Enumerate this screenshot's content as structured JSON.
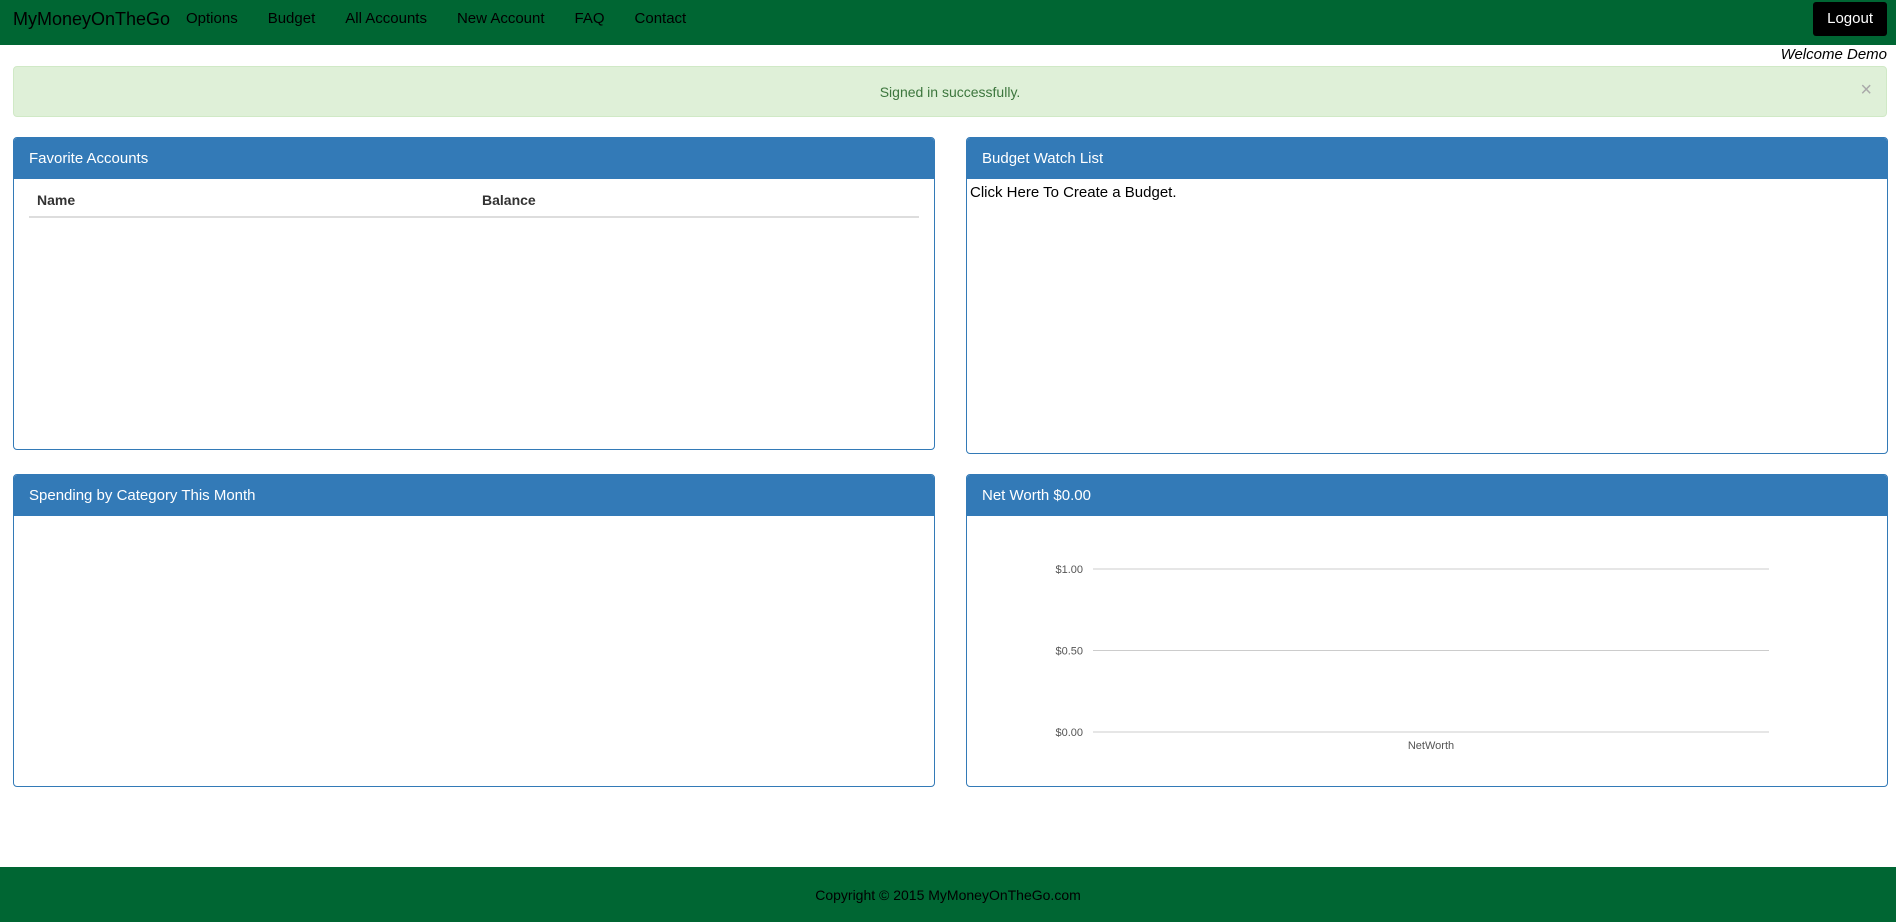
{
  "navbar": {
    "brand": "MyMoneyOnTheGo",
    "links": [
      "Options",
      "Budget",
      "All Accounts",
      "New Account",
      "FAQ",
      "Contact"
    ],
    "logout_label": "Logout",
    "color": "#006633"
  },
  "welcome": "Welcome Demo",
  "alert": {
    "message": "Signed in successfully.",
    "close_glyph": "×"
  },
  "favorite_accounts": {
    "title": "Favorite Accounts",
    "columns": [
      "Name",
      "Balance"
    ]
  },
  "budget_watch": {
    "title": "Budget Watch List",
    "link_text": "Click Here To Create a Budget."
  },
  "spending": {
    "title": "Spending by Category This Month"
  },
  "net_worth": {
    "title": "Net Worth $0.00"
  },
  "chart_data": {
    "type": "bar",
    "categories": [
      "NetWorth"
    ],
    "values": [
      0
    ],
    "yticks": [
      "$0.00",
      "$0.50",
      "$1.00"
    ],
    "ylim": [
      0,
      1
    ],
    "grid": true
  },
  "footer": {
    "copyright": "Copyright © 2015 MyMoneyOnTheGo.com"
  },
  "colors": {
    "panel": "#337ab7",
    "alert_bg": "#dff0d8",
    "alert_text": "#3c763d"
  }
}
